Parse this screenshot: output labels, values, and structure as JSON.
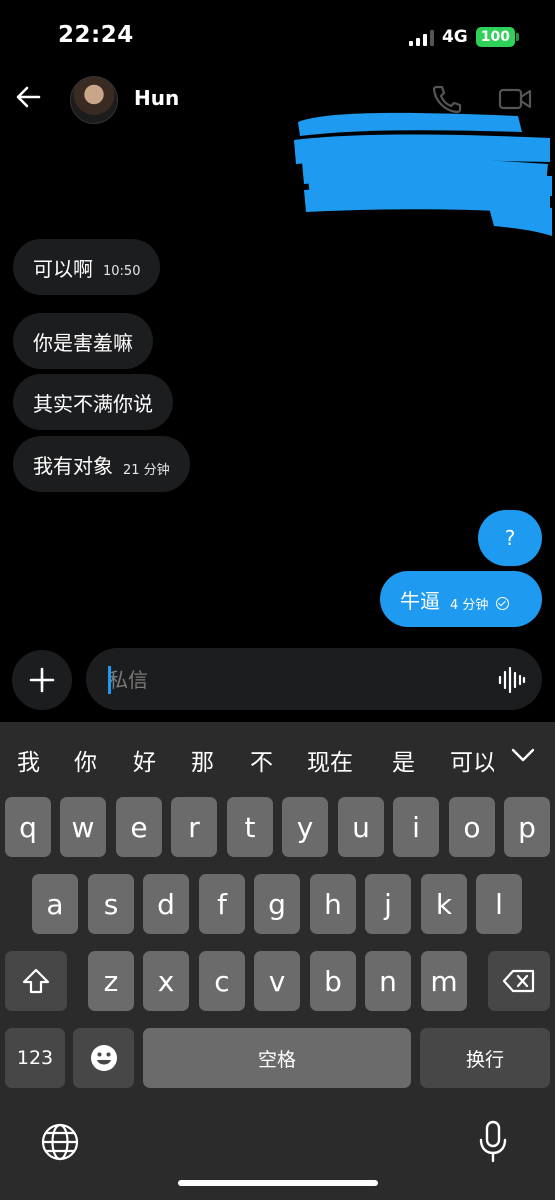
{
  "status_bar": {
    "time": "22:24",
    "network": "4G",
    "battery": "100"
  },
  "header": {
    "contact_name": "Hun"
  },
  "messages": {
    "incoming": [
      {
        "text": "可以啊",
        "time": "10:50"
      },
      {
        "text": "你是害羞嘛",
        "time": ""
      },
      {
        "text": "其实不满你说",
        "time": ""
      },
      {
        "text": "我有对象",
        "time": "21 分钟"
      }
    ],
    "outgoing": [
      {
        "text": "?",
        "time": ""
      },
      {
        "text": "牛逼",
        "time": "4 分钟"
      }
    ]
  },
  "composer": {
    "placeholder": "私信"
  },
  "keyboard": {
    "candidates": [
      "我",
      "你",
      "好",
      "那",
      "不",
      "现在",
      "是",
      "可以"
    ],
    "row1": [
      "q",
      "w",
      "e",
      "r",
      "t",
      "y",
      "u",
      "i",
      "o",
      "p"
    ],
    "row2": [
      "a",
      "s",
      "d",
      "f",
      "g",
      "h",
      "j",
      "k",
      "l"
    ],
    "row3": [
      "z",
      "x",
      "c",
      "v",
      "b",
      "n",
      "m"
    ],
    "numbers_key": "123",
    "space_key": "空格",
    "return_key": "换行"
  },
  "colors": {
    "accent": "#1e9bf0",
    "incoming_bubble": "#1c1d1f",
    "battery": "#2fd158"
  }
}
